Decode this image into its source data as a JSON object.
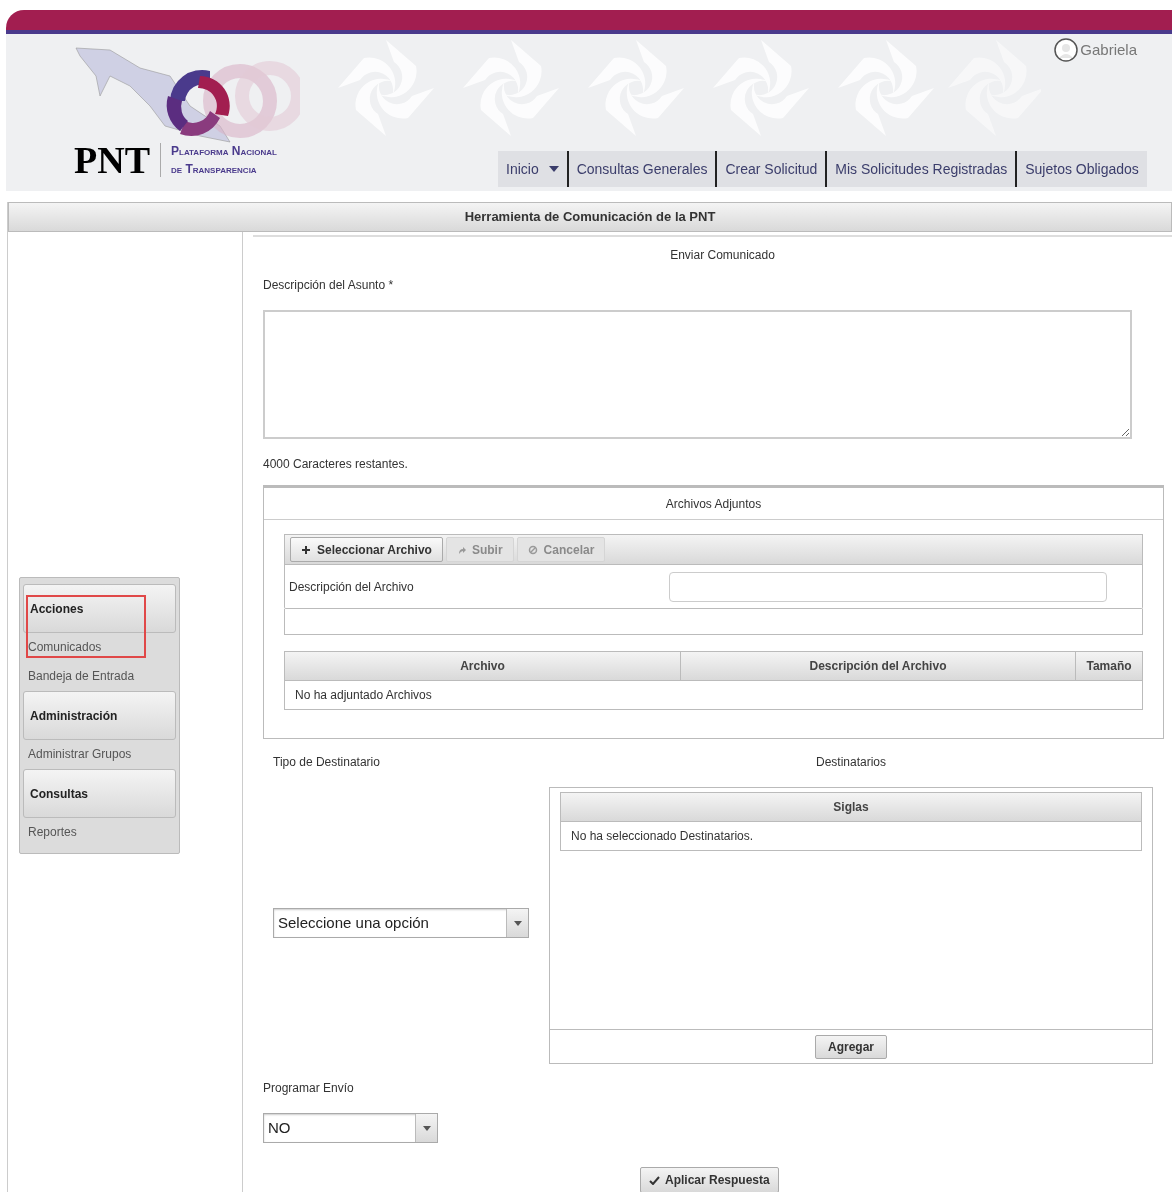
{
  "header": {
    "logo": {
      "acronym": "PNT",
      "name_line1": "Plataforma Nacional",
      "name_line2": "de Transparencia"
    },
    "user": "Gabriela",
    "nav": [
      {
        "label": "Inicio",
        "dropdown": true
      },
      {
        "label": "Consultas Generales",
        "dropdown": false
      },
      {
        "label": "Crear Solicitud",
        "dropdown": false
      },
      {
        "label": "Mis Solicitudes Registradas",
        "dropdown": false
      },
      {
        "label": "Sujetos Obligados",
        "dropdown": false
      }
    ]
  },
  "panel_title": "Herramienta de Comunicación de la PNT",
  "sidebar": [
    {
      "title": "Acciones",
      "highlighted": true,
      "items": [
        "Comunicados",
        "Bandeja de Entrada"
      ]
    },
    {
      "title": "Administración",
      "highlighted": false,
      "items": [
        "Administrar Grupos"
      ]
    },
    {
      "title": "Consultas",
      "highlighted": false,
      "items": [
        "Reportes"
      ]
    }
  ],
  "form": {
    "title": "Enviar Comunicado",
    "subject_label": "Descripción del Asunto",
    "required_mark": "*",
    "counter": "4000 Caracteres restantes.",
    "attachments": {
      "title": "Archivos Adjuntos",
      "buttons": [
        {
          "label": "Seleccionar Archivo",
          "disabled": false
        },
        {
          "label": "Subir",
          "disabled": true
        },
        {
          "label": "Cancelar",
          "disabled": true
        }
      ],
      "description_label": "Descripción del Archivo",
      "columns": [
        "Archivo",
        "Descripción del Archivo",
        "Tamaño"
      ],
      "empty_message": "No ha adjuntado Archivos"
    },
    "recipient_type": {
      "label": "Tipo de Destinatario",
      "value": "Seleccione una opción"
    },
    "recipients": {
      "label": "Destinatarios",
      "columns": [
        "Siglas"
      ],
      "empty_message": "No ha seleccionado Destinatarios.",
      "add_button": "Agregar"
    },
    "schedule": {
      "label": "Programar Envío",
      "value": "NO"
    },
    "submit": "Aplicar Respuesta"
  }
}
